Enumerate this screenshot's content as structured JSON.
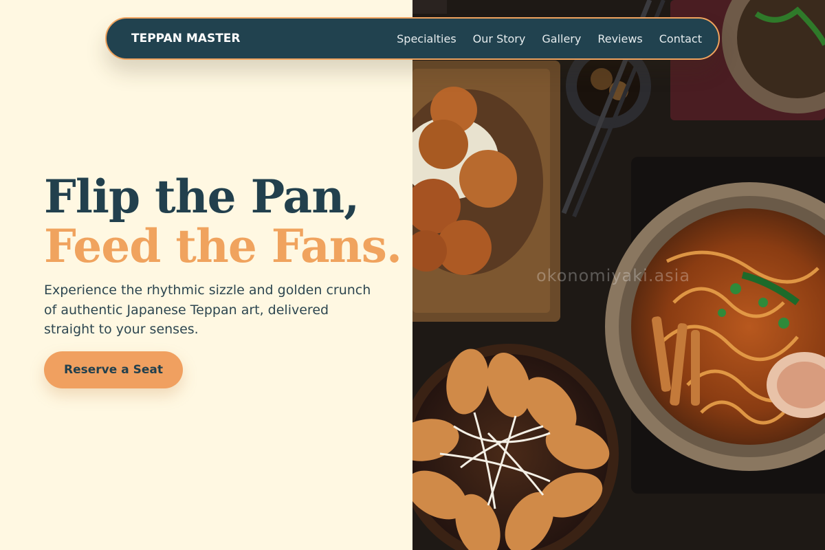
{
  "brand": "TEPPAN MASTER",
  "nav": [
    {
      "label": "Specialties"
    },
    {
      "label": "Our Story"
    },
    {
      "label": "Gallery"
    },
    {
      "label": "Reviews"
    },
    {
      "label": "Contact"
    }
  ],
  "hero": {
    "headline_line1": "Flip the Pan,",
    "headline_line2": "Feed the Fans.",
    "subtext": "Experience the rhythmic sizzle and golden crunch of authentic Japanese Teppan art, delivered straight to your senses.",
    "cta_label": "Reserve a Seat"
  },
  "image": {
    "watermark": "okonomiyaki.asia"
  },
  "colors": {
    "background": "#fff8e2",
    "navy": "#21424f",
    "accent": "#f0a35e"
  }
}
